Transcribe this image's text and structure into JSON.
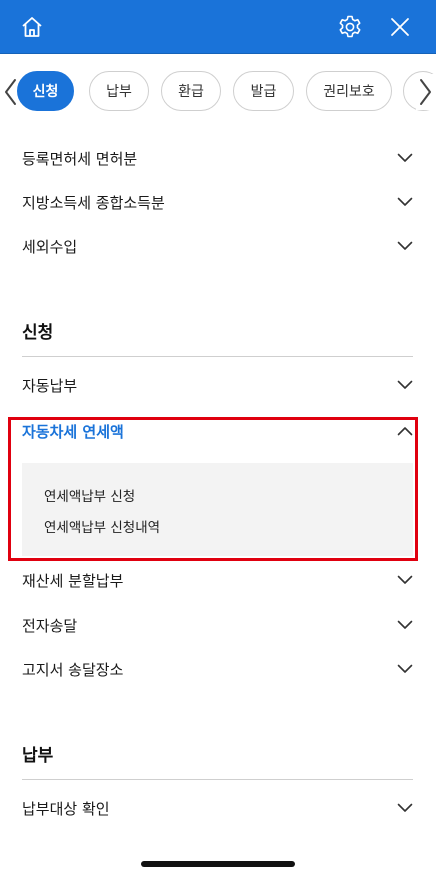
{
  "header": {
    "home_icon": "home-icon",
    "settings_icon": "gear-icon",
    "close_icon": "close-icon",
    "background": "#1a73d9"
  },
  "tabs": {
    "items": [
      {
        "label": "신청",
        "active": true
      },
      {
        "label": "납부",
        "active": false
      },
      {
        "label": "환급",
        "active": false
      },
      {
        "label": "발급",
        "active": false
      },
      {
        "label": "권리보호",
        "active": false
      }
    ],
    "prev_icon": "chevron-left-icon",
    "next_icon": "chevron-right-icon"
  },
  "top_rows": [
    {
      "label": "등록면허세 면허분"
    },
    {
      "label": "지방소득세 종합소득분"
    },
    {
      "label": "세외수입"
    }
  ],
  "section_apply": {
    "title": "신청",
    "rows": [
      {
        "label": "자동납부",
        "expanded": false
      },
      {
        "label": "자동차세 연세액",
        "expanded": true
      },
      {
        "label": "재산세 분할납부",
        "expanded": false
      },
      {
        "label": "전자송달",
        "expanded": false
      },
      {
        "label": "고지서 송달장소",
        "expanded": false
      }
    ],
    "submenu": [
      {
        "label": "연세액납부 신청"
      },
      {
        "label": "연세액납부 신청내역"
      }
    ]
  },
  "section_pay": {
    "title": "납부",
    "rows": [
      {
        "label": "납부대상 확인",
        "expanded": false
      }
    ]
  },
  "colors": {
    "accent": "#1a73d9",
    "highlight_border": "#e0000f",
    "submenu_bg": "#f3f3f3"
  }
}
